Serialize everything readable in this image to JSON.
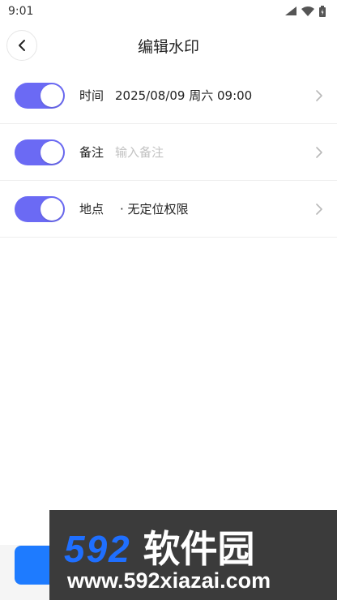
{
  "status_bar": {
    "time": "9:01"
  },
  "header": {
    "title": "编辑水印"
  },
  "rows": [
    {
      "label": "时间",
      "value": "2025/08/09 周六 09:00",
      "enabled": true
    },
    {
      "label": "备注",
      "placeholder": "输入备注",
      "enabled": true
    },
    {
      "label": "地点",
      "value": "· 无定位权限",
      "enabled": true
    }
  ],
  "watermark": {
    "brand_number": "592",
    "brand_name": "软件园",
    "url": "www.592xiazai.com"
  },
  "colors": {
    "toggle_on": "#6b6af4",
    "primary": "#1e7bff"
  }
}
